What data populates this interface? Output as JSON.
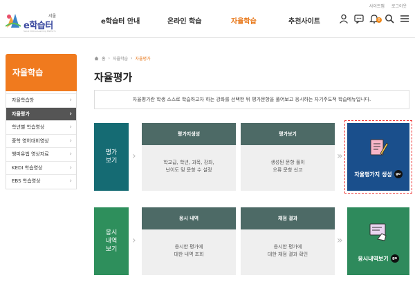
{
  "util": {
    "sitemap": "사이트맵",
    "logout": "로그아웃"
  },
  "logo": {
    "city": "서울",
    "brand": "e학습터",
    "tag": "Seoul Online Learning Platform"
  },
  "gnb": [
    {
      "label": "e학습터 안내"
    },
    {
      "label": "온라인 학습"
    },
    {
      "label": "자율학습"
    },
    {
      "label": "추천사이트"
    }
  ],
  "header_icons": {
    "bell_badge": "0"
  },
  "sidebar": {
    "title": "자율학습",
    "items": [
      {
        "label": "자율학습방"
      },
      {
        "label": "자율평가"
      },
      {
        "label": "학년별 학습영상"
      },
      {
        "label": "중학 영어대비영상"
      },
      {
        "label": "행미유법 영상자료"
      },
      {
        "label": "KEDI 학습영상"
      },
      {
        "label": "EBS 학습영상"
      }
    ]
  },
  "breadcrumb": {
    "home": "홈",
    "level1": "자율학습",
    "current": "자율평가"
  },
  "page": {
    "title": "자율평가",
    "description": "자율평가란 학생 스스로 학습하고자 하는 강좌를 선택한 뒤 평가문항을 풀어보고 응시하는 자기주도적 학습메뉴입니다."
  },
  "eval_row": {
    "label_line1": "평가",
    "label_line2": "보기",
    "card1": {
      "title": "평가지생성",
      "line1": "학교급, 학년, 과목, 강좌,",
      "line2": "난이도 및 문항 수 설정"
    },
    "card2": {
      "title": "평가보기",
      "line1": "생성된 문항 풀이",
      "line2": "오류 문항 신고"
    },
    "action": {
      "label": "자율평가지 생성",
      "go": "go"
    }
  },
  "history_row": {
    "label_line1": "응시",
    "label_line2": "내역",
    "label_line3": "보기",
    "card1": {
      "title": "응시 내역",
      "line1": "응시한 평가에",
      "line2": "대한 내역 조회"
    },
    "card2": {
      "title": "채점 결과",
      "line1": "응시한 평가에",
      "line2": "대한 채점 결과 확인"
    },
    "action": {
      "label": "응시내역보기",
      "go": "go"
    }
  },
  "colors": {
    "accent": "#f07a1e",
    "eval_label": "#156b73",
    "history_label": "#2e8f5c",
    "card_header": "#4d6a66",
    "eval_action": "#1a4f8c",
    "history_action": "#2e8a5c",
    "highlight": "#e33333"
  }
}
